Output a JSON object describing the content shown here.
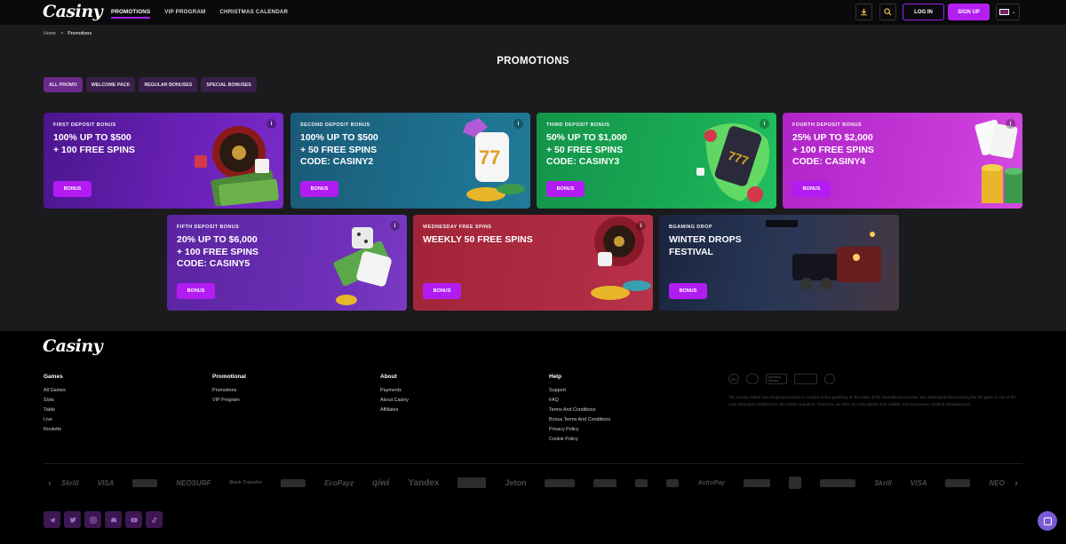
{
  "header": {
    "logo": "Casiny",
    "nav": [
      "PROMOTIONS",
      "VIP PROGRAM",
      "CHRISTMAS CALENDAR"
    ],
    "login": "LOG IN",
    "signup": "SIGN UP"
  },
  "breadcrumb": {
    "home": "Home",
    "current": "Promotions",
    "sep": ">"
  },
  "page_title": "PROMOTIONS",
  "filters": [
    "ALL PROMO",
    "WELCOME PACK",
    "REGULAR BONUSES",
    "SPECIAL BONUSES"
  ],
  "cards": [
    {
      "tag": "FIRST DEPOSIT BONUS",
      "title": "100% UP TO $500\n+ 100 FREE SPINS",
      "button": "BONUS",
      "color": "#5a1aa0"
    },
    {
      "tag": "SECOND DEPOSIT BONUS",
      "title": "100% UP TO $500\n+ 50 FREE SPINS\nCODE: CASINY2",
      "button": "BONUS",
      "color": "#1d6a86"
    },
    {
      "tag": "THIRD DEPOSIT BONUS",
      "title": "50% UP TO $1,000\n+ 50 FREE SPINS\nCODE: CASINY3",
      "button": "BONUS",
      "color": "#17a04a"
    },
    {
      "tag": "FOURTH DEPOSIT BONUS",
      "title": "25% UP TO $2,000\n+ 100 FREE SPINS\nCODE: CASINY4",
      "button": "BONUS",
      "color": "#c32bd0"
    },
    {
      "tag": "FIFTH DEPOSIT BONUS",
      "title": "20% UP TO $6,000\n+ 100 FREE SPINS\nCODE: CASINY5",
      "button": "BONUS",
      "color": "#6a2eb0"
    },
    {
      "tag": "WEDNESDAY FREE SPINS",
      "title": "WEEKLY 50 FREE SPINS",
      "button": "BONUS",
      "color": "#a8283e"
    },
    {
      "tag": "BGAMING DROP",
      "title": "WINTER DROPS\nFESTIVAL",
      "button": "BONUS",
      "color": "#1b2a4a"
    }
  ],
  "footer": {
    "logo": "Casiny",
    "columns": [
      {
        "title": "Games",
        "links": [
          "All Games",
          "Slots",
          "Table",
          "Live",
          "Roulette"
        ]
      },
      {
        "title": "Promotional",
        "links": [
          "Promotions",
          "VIP Program"
        ]
      },
      {
        "title": "About",
        "links": [
          "Payments",
          "About Casiny",
          "Affiliates"
        ]
      },
      {
        "title": "Help",
        "links": [
          "Support",
          "FAQ",
          "Terms And Conditions",
          "Bonus Terms And Conditions",
          "Privacy Policy",
          "Cookie Policy"
        ]
      }
    ],
    "licenses": [
      "18+",
      "gambling therapy"
    ],
    "disclaimer": "The Casiny Online has a legal permission to conduct online gambling on the basis of the international License. We understand that ensuring the fair game is one of the most important conditions for the casino operation. Therefore, we offer you only games from reliable and long proven certified manufacturers.",
    "payments": [
      "Skrill",
      "VISA",
      "",
      "NEOSURF",
      "Bank Transfer",
      "",
      "EcoPayz",
      "qiwi",
      "Yandex",
      "",
      "Jeton",
      "",
      "",
      "",
      "",
      "AstroPay",
      "",
      "",
      "",
      "Skrill",
      "VISA",
      "",
      "NEO"
    ],
    "socials": [
      "telegram",
      "twitter",
      "instagram",
      "discord",
      "youtube",
      "tiktok"
    ]
  }
}
